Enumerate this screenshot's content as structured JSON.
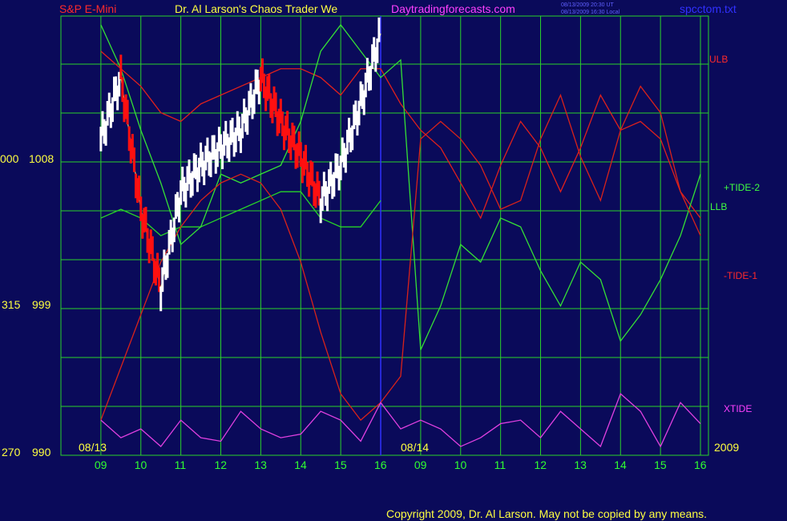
{
  "header": {
    "symbol": "S&P E-Mini",
    "title": "Dr. Al Larson's Chaos Trader We",
    "site": "Daytradingforecasts.com",
    "timestamp_ut": "08/13/2009 20:30 UT",
    "timestamp_local": "08/13/2009 16:30 Local",
    "filename": "spcctom.txt"
  },
  "footer": {
    "copyright": "Copyright 2009, Dr. Al Larson. May not be copied by any means.",
    "year": "2009"
  },
  "colors": {
    "background": "#0a0a5a",
    "grid": "#2bd22b",
    "ulb": "#e0201c",
    "llb": "#28d428",
    "tide_plus2": "#35e035",
    "tide_minus1": "#d8221a",
    "xtide": "#e040e0",
    "price_up": "#ffffff",
    "price_down": "#ff1010",
    "cursor": "#3030ff",
    "axis_y": "#ffff40",
    "axis_x": "#30ff30"
  },
  "chart_data": {
    "type": "line",
    "ylim": [
      990,
      1015
    ],
    "y_ticks": [
      {
        "left": "270",
        "value": "990"
      },
      {
        "left": "315",
        "value": "999"
      },
      {
        "left": "000",
        "value": "1008"
      }
    ],
    "date_labels": [
      "08/13",
      "08/14"
    ],
    "x_tick_labels": [
      "09",
      "10",
      "11",
      "12",
      "13",
      "14",
      "15",
      "16",
      "09",
      "10",
      "11",
      "12",
      "13",
      "14",
      "15",
      "16"
    ],
    "x": [
      9.0,
      9.5,
      10.0,
      10.5,
      11.0,
      11.5,
      12.0,
      12.5,
      13.0,
      13.5,
      14.0,
      14.5,
      15.0,
      15.5,
      16.0,
      16.5,
      17.0,
      17.5,
      18.0,
      18.5,
      19.0,
      19.5,
      20.0,
      20.5,
      21.0,
      21.5,
      22.0,
      22.5,
      23.0,
      23.5,
      24.0
    ],
    "series": [
      {
        "name": "ULB",
        "values": [
          1013.0,
          1012.0,
          1011.0,
          1009.5,
          1009.0,
          1010.0,
          1010.5,
          1011.0,
          1011.5,
          1012.0,
          1012.0,
          1011.5,
          1010.5,
          1012.0,
          1012.0,
          1010.0,
          1008.5,
          1007.5,
          1005.5,
          1003.5,
          1006.5,
          1009.0,
          1007.5,
          1005.0,
          1007.5,
          1010.5,
          1008.5,
          1009.0,
          1008.0,
          1005.0,
          1003.5
        ]
      },
      {
        "name": "LLB",
        "values": [
          1003.5,
          1004.0,
          1003.5,
          1002.5,
          1003.0,
          1003.0,
          1003.5,
          1004.0,
          1004.5,
          1005.0,
          1005.0,
          1003.5,
          1003.0,
          1003.0,
          1004.5
        ]
      },
      {
        "name": "+TIDE-2",
        "values": [
          1014.5,
          1012.0,
          1008.5,
          1005.5,
          1002.0,
          1003.0,
          1006.0,
          1005.5,
          1006.0,
          1006.5,
          1009.0,
          1013.0,
          1014.5,
          1013.0,
          1011.5,
          1012.5,
          996.0,
          998.5,
          1002.0,
          1001.0,
          1003.5,
          1003.0,
          1000.5,
          998.5,
          1001.0,
          1000.0,
          996.5,
          998.0,
          1000.0,
          1002.5,
          1006.0
        ]
      },
      {
        "name": "-TIDE-1",
        "values": [
          992.0,
          995.0,
          998.0,
          1001.0,
          1003.0,
          1004.5,
          1005.5,
          1006.0,
          1005.5,
          1004.0,
          1001.0,
          997.0,
          993.5,
          992.0,
          993.0,
          994.5,
          1008.0,
          1009.0,
          1008.0,
          1006.5,
          1004.0,
          1004.5,
          1008.0,
          1010.5,
          1007.0,
          1004.5,
          1008.5,
          1011.0,
          1009.5,
          1005.0,
          1002.5
        ]
      },
      {
        "name": "XTIDE",
        "values": [
          992.0,
          991.0,
          991.5,
          990.5,
          992.0,
          991.0,
          990.8,
          992.5,
          991.5,
          991.0,
          991.2,
          992.5,
          992.0,
          990.8,
          993.0,
          991.5,
          992.0,
          991.5,
          990.5,
          991.0,
          991.8,
          992.0,
          991.0,
          992.5,
          991.5,
          990.5,
          993.5,
          992.5,
          990.5,
          993.0,
          991.8
        ]
      },
      {
        "name": "Price",
        "values": [
          1008.0,
          1011.5,
          1004.0,
          999.5,
          1005.0,
          1006.5,
          1007.5,
          1008.5,
          1011.5,
          1009.0,
          1007.0,
          1004.5,
          1006.5,
          1010.0,
          1014.0
        ]
      }
    ],
    "annotations": [
      "ULB",
      "+TIDE-2",
      "LLB",
      "-TIDE-1",
      "XTIDE"
    ]
  }
}
